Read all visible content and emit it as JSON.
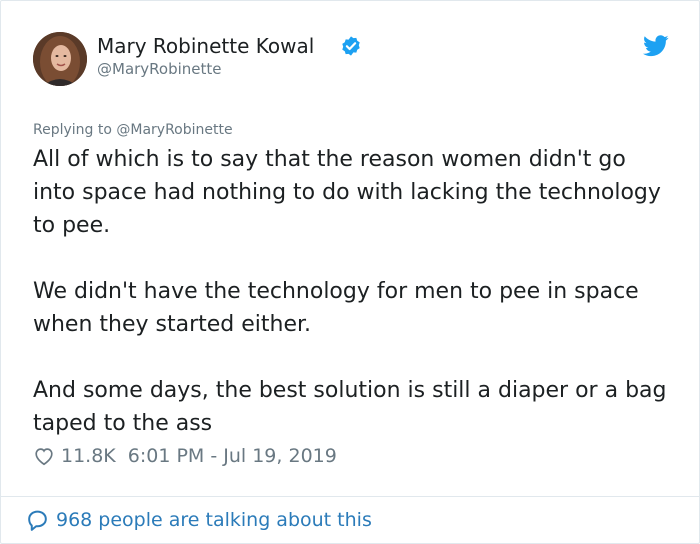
{
  "author": {
    "name": "Mary Robinette Kowal",
    "handle": "@MaryRobinette",
    "verified_icon": "verified-badge-icon",
    "avatar_icon": "avatar"
  },
  "platform_icon": "twitter-bird-icon",
  "reply_to": "Replying to @MaryRobinette",
  "tweet": {
    "paragraphs": [
      "All of which is to say that the reason women didn't go into space had nothing to do with lacking the technology to pee.",
      "We didn't have the technology for men to pee in space when they started either.",
      "And some days, the best solution is still a diaper or a bag taped to the ass"
    ]
  },
  "meta": {
    "likes": "11.8K",
    "timestamp": "6:01 PM - Jul 19, 2019",
    "like_icon": "heart-icon"
  },
  "footer": {
    "talking": "968 people are talking about this",
    "icon": "speech-bubble-icon"
  },
  "colors": {
    "text": "#1c2022",
    "muted": "#697882",
    "link": "#2b7bb9",
    "verified": "#1da1f2",
    "border": "#e1e8ed"
  }
}
